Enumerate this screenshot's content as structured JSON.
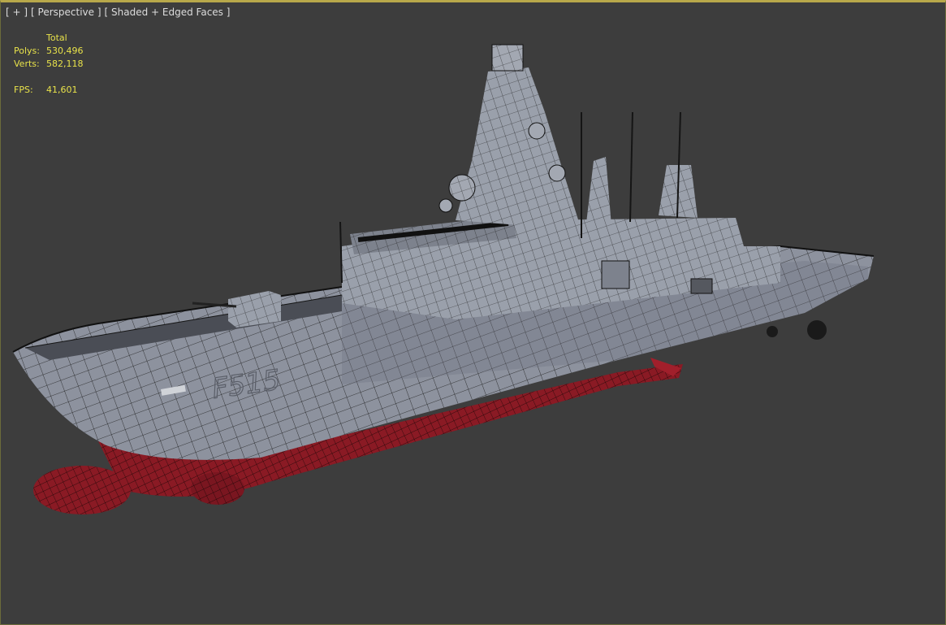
{
  "viewport": {
    "labels": {
      "plus": "[ + ]",
      "view": "[ Perspective ]",
      "shading": "[ Shaded + Edged Faces ]"
    }
  },
  "stats": {
    "header": "Total",
    "polys_label": "Polys:",
    "polys_value": "530,496",
    "verts_label": "Verts:",
    "verts_value": "582,118",
    "fps_label": "FPS:",
    "fps_value": "41,601"
  },
  "model": {
    "hull_number": "F515",
    "colors": {
      "background": "#3d3d3d",
      "hull": "#8d929e",
      "hull_dark": "#6f7480",
      "superstructure": "#9aa0ab",
      "waterline_red": "#8a1a24",
      "wire": "#1a1a1a",
      "stats_text": "#e8e24a",
      "viewport_border": "#b8a84a"
    }
  }
}
